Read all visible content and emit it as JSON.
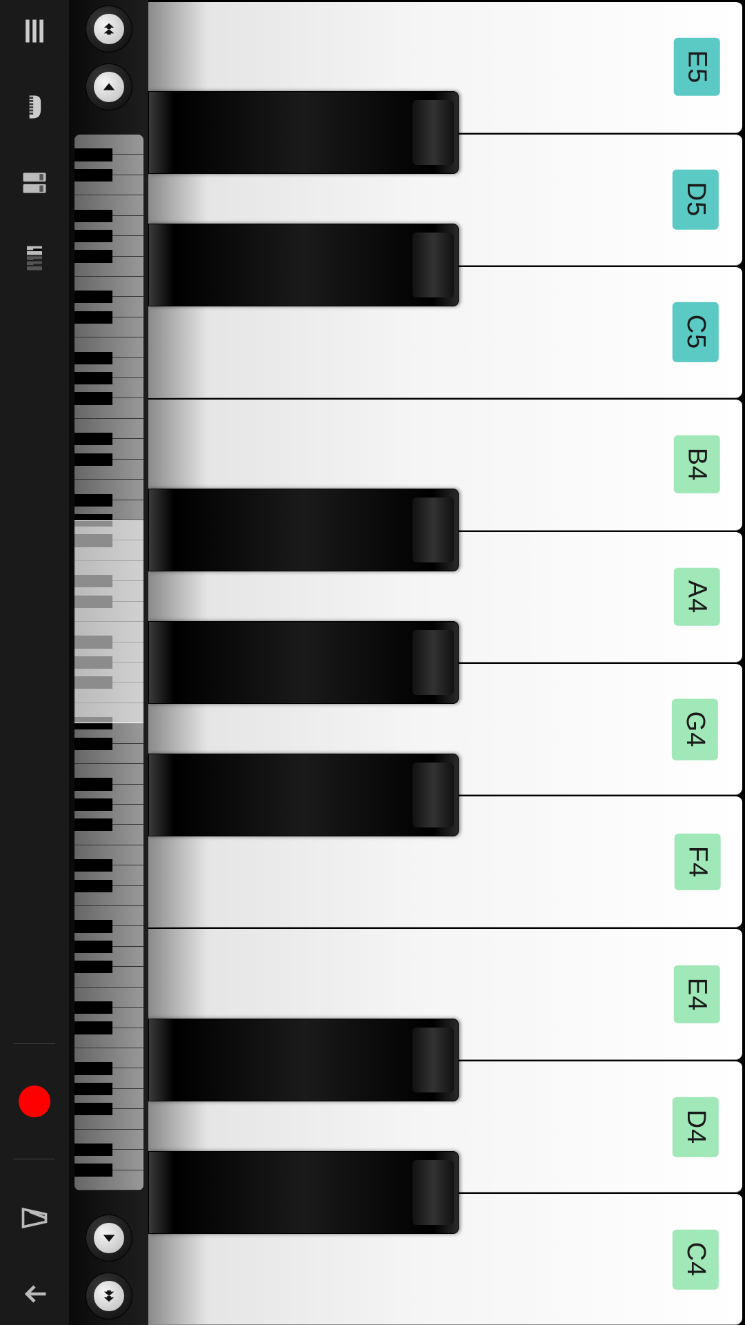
{
  "keyboard": {
    "white_keys": [
      {
        "note": "C4",
        "label_style": "green",
        "has_black_above": true
      },
      {
        "note": "D4",
        "label_style": "green",
        "has_black_above": true
      },
      {
        "note": "E4",
        "label_style": "green",
        "has_black_above": false
      },
      {
        "note": "F4",
        "label_style": "green",
        "has_black_above": true
      },
      {
        "note": "G4",
        "label_style": "green",
        "has_black_above": true
      },
      {
        "note": "A4",
        "label_style": "green",
        "has_black_above": true
      },
      {
        "note": "B4",
        "label_style": "green",
        "has_black_above": false
      },
      {
        "note": "C5",
        "label_style": "teal",
        "has_black_above": true
      },
      {
        "note": "D5",
        "label_style": "teal",
        "has_black_above": true
      },
      {
        "note": "E5",
        "label_style": "teal",
        "has_black_above": false
      }
    ],
    "black_keys": [
      "Cs4",
      "Ds4",
      "Fs4",
      "Gs4",
      "As4",
      "Cs5",
      "Ds5"
    ]
  },
  "navigator": {
    "total_white_keys": 52,
    "visible_start_index": 23,
    "visible_count": 10
  },
  "toolbar": {
    "menu": "menu",
    "instrument": "piano",
    "sound_preset": "sound-preset",
    "keyboard_mode": "keyboard-mode",
    "record": "record",
    "metronome": "metronome",
    "download": "download"
  }
}
